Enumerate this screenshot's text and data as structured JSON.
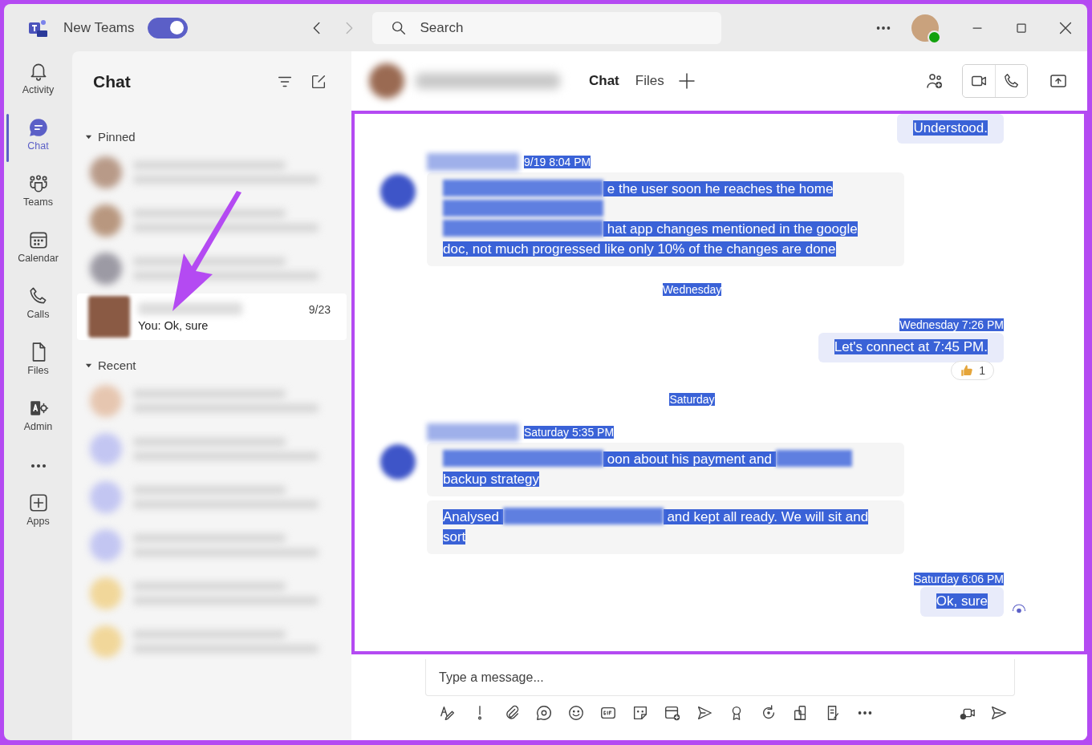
{
  "title_bar": {
    "toggle": {
      "label": "New Teams",
      "on": true
    },
    "search": {
      "placeholder": "Search"
    }
  },
  "rail": [
    {
      "label": "Activity",
      "selected": false
    },
    {
      "label": "Chat",
      "selected": true
    },
    {
      "label": "Teams",
      "selected": false
    },
    {
      "label": "Calendar",
      "selected": false
    },
    {
      "label": "Calls",
      "selected": false
    },
    {
      "label": "Files",
      "selected": false
    },
    {
      "label": "Admin",
      "selected": false
    },
    {
      "label": "Apps",
      "selected": false
    }
  ],
  "chat_list": {
    "title": "Chat",
    "sections": [
      {
        "label": "Pinned",
        "expanded": true,
        "rows": [
          {
            "kind": "blurred",
            "color": "#b89a88"
          },
          {
            "kind": "blurred",
            "color": "#b8977f"
          },
          {
            "kind": "blurred",
            "color": "#9c9aa4"
          },
          {
            "kind": "chat",
            "selected": true,
            "date": "9/23",
            "preview": "You: Ok, sure",
            "color": "#8a5a44"
          }
        ]
      },
      {
        "label": "Recent",
        "expanded": true,
        "rows": [
          {
            "kind": "blurred",
            "color": "#e6c6b0"
          },
          {
            "kind": "blurred",
            "color": "#c3c6f2"
          },
          {
            "kind": "blurred",
            "color": "#c3c6f2"
          },
          {
            "kind": "blurred",
            "color": "#c3c6f2"
          },
          {
            "kind": "blurred",
            "color": "#f1d79a"
          },
          {
            "kind": "blurred",
            "color": "#f1d79a"
          }
        ]
      }
    ]
  },
  "conversation": {
    "tabs": [
      {
        "label": "Chat",
        "selected": true
      },
      {
        "label": "Files",
        "selected": false
      }
    ],
    "messages": [
      {
        "kind": "own",
        "highlighted": true,
        "bubbles": [
          [
            [
              {
                "kind": "text",
                "text": "Understood."
              }
            ]
          ]
        ]
      },
      {
        "kind": "other",
        "highlighted": true,
        "time": "9/19 8:04 PM",
        "bubbles": [
          [
            [
              {
                "kind": "redacted"
              },
              {
                "kind": "text",
                "text": "e the user soon he reaches the home"
              }
            ],
            [
              {
                "kind": "redacted"
              }
            ],
            [
              {
                "kind": "redacted"
              },
              {
                "kind": "text",
                "text": "hat app changes mentioned in the google"
              }
            ],
            [
              {
                "kind": "text",
                "text": "doc, not much progressed like only 10% of the changes are done"
              }
            ]
          ]
        ]
      },
      {
        "kind": "divider",
        "highlighted": true,
        "text": "Wednesday"
      },
      {
        "kind": "own",
        "highlighted": true,
        "time": "Wednesday 7:26 PM",
        "bubbles": [
          [
            [
              {
                "kind": "text",
                "text": "Let's connect at 7:45 PM."
              }
            ]
          ]
        ],
        "reaction": {
          "count": "1"
        }
      },
      {
        "kind": "divider",
        "highlighted": true,
        "text": "Saturday"
      },
      {
        "kind": "other",
        "highlighted": true,
        "time": "Saturday 5:35 PM",
        "bubbles": [
          [
            [
              {
                "kind": "redacted"
              },
              {
                "kind": "text",
                "text": "oon about his payment and"
              },
              {
                "kind": "redacted"
              }
            ],
            [
              {
                "kind": "text",
                "text": "backup strategy"
              }
            ]
          ],
          [
            [
              {
                "kind": "text",
                "text": "Analysed"
              },
              {
                "kind": "redacted"
              },
              {
                "kind": "text",
                "text": "and kept all ready. We will sit and"
              }
            ],
            [
              {
                "kind": "text",
                "text": "sort"
              }
            ]
          ]
        ]
      },
      {
        "kind": "own",
        "highlighted": true,
        "time": "Saturday 6:06 PM",
        "bubbles": [
          [
            [
              {
                "kind": "text",
                "text": "Ok, sure"
              }
            ]
          ]
        ],
        "seen": true
      }
    ]
  },
  "composer": {
    "placeholder": "Type a message..."
  }
}
